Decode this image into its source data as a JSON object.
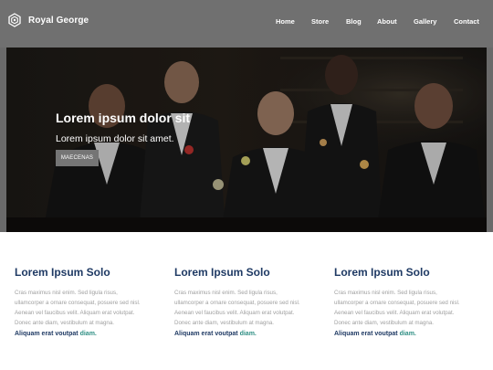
{
  "brand": {
    "name": "Royal George",
    "logo_icon": "gear-logo-icon"
  },
  "nav": {
    "items": [
      {
        "label": "Home"
      },
      {
        "label": "Store"
      },
      {
        "label": "Blog"
      },
      {
        "label": "About"
      },
      {
        "label": "Gallery"
      },
      {
        "label": "Contact"
      }
    ]
  },
  "hero": {
    "title": "Lorem ipsum dolor sit",
    "subtitle": "Lorem ipsum dolor sit amet.",
    "button_label": "MAECENAS"
  },
  "columns": [
    {
      "title": "Lorem Ipsum Solo",
      "body_lines": [
        "Cras maximus nisl enim. Sed ligula risus,",
        "ullamcorper a ornare consequat, posuere sed nisl.",
        "Aenean vel faucibus velit. Aliquam erat volutpat.",
        "Donec ante diam, vestibulum at magna."
      ],
      "link_text": "Aliquam erat voutpat",
      "link_accent": "diam."
    },
    {
      "title": "Lorem Ipsum Solo",
      "body_lines": [
        "Cras maximus nisl enim. Sed ligula risus,",
        "ullamcorper a ornare consequat, posuere sed nisl.",
        "Aenean vel faucibus velit. Aliquam erat volutpat.",
        "Donec ante diam, vestibulum at magna."
      ],
      "link_text": "Aliquam erat voutpat",
      "link_accent": "diam."
    },
    {
      "title": "Lorem Ipsum Solo",
      "body_lines": [
        "Cras maximus nisl enim. Sed ligula risus,",
        "ullamcorper a ornare consequat, posuere sed nisl.",
        "Aenean vel faucibus velit. Aliquam erat volutpat.",
        "Donec ante diam, vestibulum at magna."
      ],
      "link_text": "Aliquam erat voutpat",
      "link_accent": "diam."
    }
  ],
  "colors": {
    "header_bg": "#707070",
    "heading": "#1f3a64",
    "link_accent": "#2f8f84",
    "body_text": "#a0a0a0",
    "button_bg": "#757575"
  }
}
